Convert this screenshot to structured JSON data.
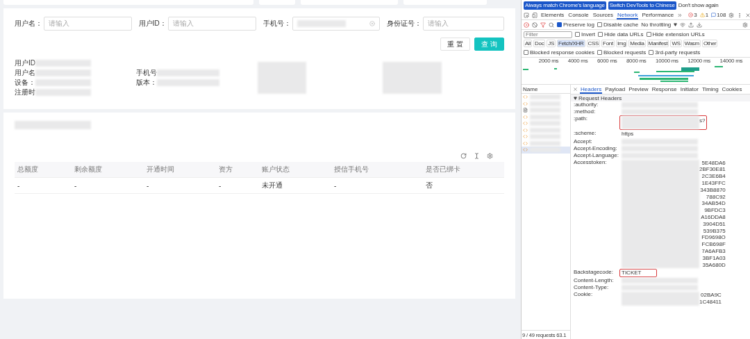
{
  "search_form": {
    "fields": [
      {
        "label": "用户名：",
        "placeholder": "请输入"
      },
      {
        "label": "用户ID：",
        "placeholder": "请输入"
      },
      {
        "label": "手机号：",
        "kind": "filled"
      },
      {
        "label": "身份证号：",
        "placeholder": "请输入"
      }
    ],
    "buttons": [
      {
        "label": "重 置",
        "kind": "default"
      },
      {
        "label": "查 询",
        "kind": "primary"
      }
    ]
  },
  "user_info": {
    "columns": [
      [
        "用户ID",
        "用户名",
        "设备：",
        "注册时"
      ],
      [
        "手机号",
        "版本："
      ]
    ]
  },
  "table": {
    "columns": [
      "总额度",
      "剩余额度",
      "开通时间",
      "资方",
      "账户状态",
      "授信手机号",
      "是否已绑卡"
    ],
    "rows": [
      [
        "-",
        "-",
        "-",
        "-",
        "未开通",
        "-",
        "否"
      ]
    ]
  },
  "devtools": {
    "banner": {
      "buttons": [
        "Always match Chrome's language",
        "Switch DevTools to Chinese"
      ],
      "link": "Don't show again"
    },
    "tabs": [
      {
        "label": "Elements",
        "selected": false
      },
      {
        "label": "Console",
        "selected": false
      },
      {
        "label": "Sources",
        "selected": false
      },
      {
        "label": "Network",
        "selected": true
      },
      {
        "label": "Performance",
        "selected": false
      }
    ],
    "counts": {
      "errors": "3",
      "warnings": "1",
      "messages": "108"
    },
    "toolbar": {
      "checkboxes": [
        {
          "label": "Preserve log",
          "checked": true
        },
        {
          "label": "Disable cache",
          "checked": false
        }
      ],
      "throttling": "No throttling"
    },
    "filter": {
      "placeholder": "Filter",
      "checkboxes": [
        {
          "label": "Invert",
          "checked": false
        },
        {
          "label": "Hide data URLs",
          "checked": false
        },
        {
          "label": "Hide extension URLs",
          "checked": false
        }
      ]
    },
    "type_chips": [
      {
        "label": "All",
        "selected": false
      },
      {
        "label": "Doc",
        "selected": false
      },
      {
        "label": "JS",
        "selected": false
      },
      {
        "label": "Fetch/XHR",
        "selected": true
      },
      {
        "label": "CSS",
        "selected": false
      },
      {
        "label": "Font",
        "selected": false
      },
      {
        "label": "Img",
        "selected": false
      },
      {
        "label": "Media",
        "selected": false
      },
      {
        "label": "Manifest",
        "selected": false
      },
      {
        "label": "WS",
        "selected": false
      },
      {
        "label": "Wasm",
        "selected": false
      },
      {
        "label": "Other",
        "selected": false
      }
    ],
    "blocked": [
      {
        "label": "Blocked response cookies",
        "checked": false
      },
      {
        "label": "Blocked requests",
        "checked": false
      },
      {
        "label": "3rd-party requests",
        "checked": false
      }
    ],
    "timeline_ticks": [
      "2000 ms",
      "4000 ms",
      "6000 ms",
      "8000 ms",
      "10000 ms",
      "12000 ms",
      "14000 ms"
    ],
    "name_column": {
      "title": "Name",
      "requests": [
        {
          "kind": "xhr",
          "selected": false
        },
        {
          "kind": "xhr",
          "selected": false
        },
        {
          "kind": "doc",
          "selected": false
        },
        {
          "kind": "xhr",
          "selected": false
        },
        {
          "kind": "xhr",
          "selected": false
        },
        {
          "kind": "xhr",
          "selected": false
        },
        {
          "kind": "xhr",
          "selected": false
        },
        {
          "kind": "xhr",
          "selected": false
        },
        {
          "kind": "xhr",
          "selected": true
        }
      ],
      "status": "9 / 49 requests",
      "size": "63.1"
    },
    "detail_tabs": [
      {
        "label": "Headers",
        "selected": true
      },
      {
        "label": "Payload",
        "selected": false
      },
      {
        "label": "Preview",
        "selected": false
      },
      {
        "label": "Response",
        "selected": false
      },
      {
        "label": "Initiator",
        "selected": false
      },
      {
        "label": "Timing",
        "selected": false
      },
      {
        "label": "Cookies",
        "selected": false
      }
    ],
    "section": "Request Headers",
    "headers": [
      {
        "name": ":authority:"
      },
      {
        "name": ":method:"
      },
      {
        "name": ":path:",
        "tails": [
          "s?"
        ],
        "highlighted": true
      },
      {
        "name": ":scheme:",
        "value": "https"
      },
      {
        "name": "Accept:"
      },
      {
        "name": "Accept-Encoding:"
      },
      {
        "name": "Accept-Language:"
      },
      {
        "name": "Accesstoken:",
        "tails": [
          "5E48DA6",
          "2BF30E81",
          "2C3E6B4",
          "1E43FFC",
          "343B8870",
          "788C92",
          "34AB54D",
          "9BFDC3",
          "A16DDA8",
          "3904D51",
          "539B375",
          "FD9698O",
          "FCB698F",
          "7A6AFB3",
          "3BF1A03",
          "35A680D"
        ]
      },
      {
        "name": "Backstagecode:",
        "value": "TICKET",
        "highlighted": true
      },
      {
        "name": "Content-Length:"
      },
      {
        "name": "Content-Type:"
      },
      {
        "name": "Cookie:",
        "tails": [
          "02BA9C",
          "1C48411"
        ]
      }
    ]
  }
}
